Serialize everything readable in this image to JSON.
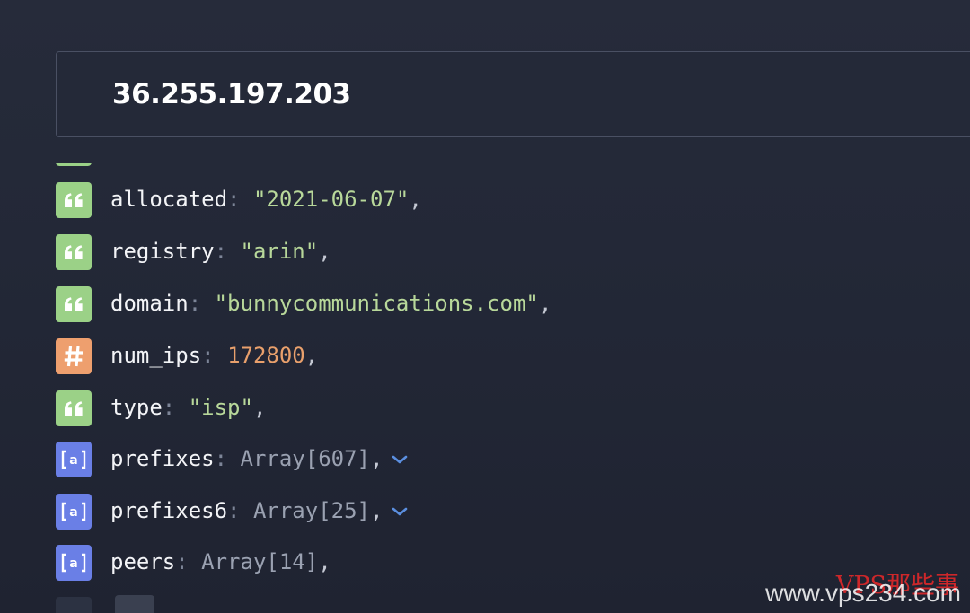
{
  "search": {
    "value": "36.255.197.203"
  },
  "colors": {
    "string_badge": "#9bd187",
    "number_badge": "#ee9f6e",
    "array_badge": "#6a7fe6",
    "string_value": "#b8d89a",
    "number_value": "#e9a06c",
    "array_value": "#9aa1b1",
    "expand_chevron": "#5b8fe0"
  },
  "rows": [
    {
      "type": "string",
      "icon": "quote-icon",
      "key": "allocated",
      "colon": ":",
      "value": "\"2021-06-07\"",
      "comma": ","
    },
    {
      "type": "string",
      "icon": "quote-icon",
      "key": "registry",
      "colon": ":",
      "value": "\"arin\"",
      "comma": ","
    },
    {
      "type": "string",
      "icon": "quote-icon",
      "key": "domain",
      "colon": ":",
      "value": "\"bunnycommunications.com\"",
      "comma": ","
    },
    {
      "type": "number",
      "icon": "hash-icon",
      "key": "num_ips",
      "colon": ":",
      "value": "172800",
      "comma": ","
    },
    {
      "type": "string",
      "icon": "quote-icon",
      "key": "type",
      "colon": ":",
      "value": "\"isp\"",
      "comma": ","
    },
    {
      "type": "array",
      "icon": "array-icon",
      "key": "prefixes",
      "colon": ":",
      "value": "Array[607]",
      "comma": ",",
      "expand_icon": "chevron-down-icon"
    },
    {
      "type": "array",
      "icon": "array-icon",
      "key": "prefixes6",
      "colon": ":",
      "value": "Array[25]",
      "comma": ",",
      "expand_icon": "chevron-down-icon"
    },
    {
      "type": "array",
      "icon": "array-icon",
      "key": "peers",
      "colon": ":",
      "value": "Array[14]",
      "comma": ","
    }
  ],
  "watermark": {
    "cn": "VPS那些事",
    "url": "www.vps234.com"
  }
}
